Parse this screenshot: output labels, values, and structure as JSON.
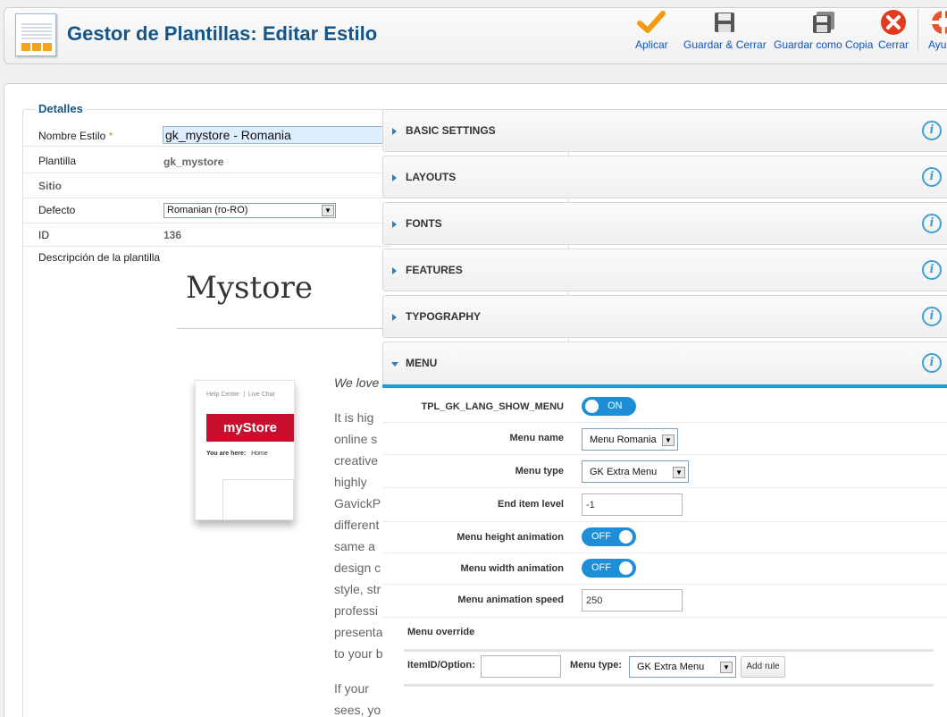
{
  "header": {
    "title": "Gestor de Plantillas: Editar Estilo",
    "buttons": {
      "apply": "Aplicar",
      "save_close": "Guardar & Cerrar",
      "save_copy": "Guardar como Copia",
      "close": "Cerrar",
      "help": "Ayuda"
    },
    "colors": {
      "title": "#14568a",
      "apply": "#f39c12",
      "close": "#e03b1e"
    }
  },
  "details": {
    "legend": "Detalles",
    "style_name_label": "Nombre Estilo",
    "required_mark": "*",
    "style_name_value": "gk_mystore - Romania",
    "template_label": "Plantilla",
    "template_value": "gk_mystore",
    "client_label": "Sitio",
    "default_label": "Defecto",
    "default_value": "Romanian (ro-RO)",
    "id_label": "ID",
    "id_value": "136",
    "description_label": "Descripción de la plantilla"
  },
  "preview": {
    "brand": "Mystore",
    "thumb_top_left": "Help Center",
    "thumb_top_right": "Live Chat",
    "thumb_logo": "myStore",
    "thumb_here_label": "You are here:",
    "thumb_here_value": "Home",
    "lines": [
      "We love",
      "It  is  hig",
      "online  s",
      "creative",
      "highly",
      "GavickP",
      "different",
      "same  a",
      "design  c",
      "style, str",
      "professi",
      "presenta",
      "to your b",
      "If  your",
      "sees, yo"
    ]
  },
  "accordion": {
    "sections": [
      "BASIC SETTINGS",
      "LAYOUTS",
      "FONTS",
      "FEATURES",
      "TYPOGRAPHY",
      "MENU"
    ],
    "info_glyph": "i"
  },
  "menu": {
    "show_menu_label": "TPL_GK_LANG_SHOW_MENU",
    "show_menu_state": "ON",
    "menu_name_label": "Menu name",
    "menu_name_value": "Menu Romania",
    "menu_type_label": "Menu type",
    "menu_type_value": "GK Extra Menu",
    "end_level_label": "End item level",
    "end_level_value": "-1",
    "height_anim_label": "Menu height animation",
    "height_anim_state": "OFF",
    "width_anim_label": "Menu width animation",
    "width_anim_state": "OFF",
    "anim_speed_label": "Menu animation speed",
    "anim_speed_value": "250",
    "override_label": "Menu override",
    "itemid_label": "ItemID/Option:",
    "itemid_value": "",
    "override_type_label": "Menu type:",
    "override_type_value": "GK Extra Menu",
    "add_rule": "Add rule"
  }
}
